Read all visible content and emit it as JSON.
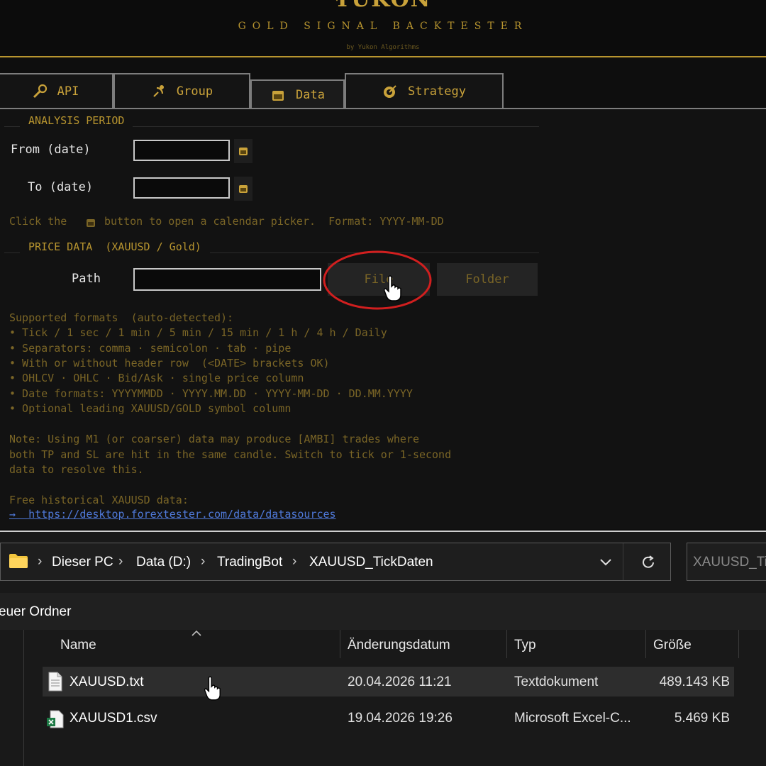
{
  "header": {
    "brand": "YUKON",
    "subtitle": "GOLD SIGNAL BACKTESTER",
    "byline": "by Yukon Algorithms"
  },
  "tabs": [
    {
      "label": "API",
      "icon": "wrench-icon"
    },
    {
      "label": "Group",
      "icon": "satellite-icon"
    },
    {
      "label": "Data",
      "icon": "calendar-icon",
      "active": true
    },
    {
      "label": "Strategy",
      "icon": "target-icon"
    }
  ],
  "analysis": {
    "title": "ANALYSIS PERIOD",
    "from_label": "From (date)",
    "to_label": "To (date)",
    "from_value": "",
    "to_value": "",
    "hint_before": "Click the",
    "hint_after": "button to open a calendar picker.  Format: YYYY-MM-DD"
  },
  "price": {
    "title": "PRICE DATA  (XAUUSD / Gold)",
    "path_label": "Path",
    "path_value": "",
    "file_button": "File",
    "folder_button": "Folder"
  },
  "formats": {
    "heading": "Supported formats  (auto-detected):",
    "items": [
      "• Tick / 1 sec / 1 min / 5 min / 15 min / 1 h / 4 h / Daily",
      "• Separators: comma · semicolon · tab · pipe",
      "• With or without header row  (<DATE> brackets OK)",
      "• OHLCV · OHLC · Bid/Ask · single price column",
      "• Date formats: YYYYMMDD · YYYY.MM.DD · YYYY-MM-DD · DD.MM.YYYY",
      "• Optional leading XAUUSD/GOLD symbol column"
    ]
  },
  "note": {
    "lines": [
      "Note: Using M1 (or coarser) data may produce [AMBI] trades where",
      "both TP and SL are hit in the same candle. Switch to tick or 1-second",
      "data to resolve this."
    ]
  },
  "free_data": {
    "label": "Free historical XAUUSD data:",
    "link": "→  https://desktop.forextester.com/data/datasources"
  },
  "explorer": {
    "breadcrumb": [
      "Dieser PC",
      "Data (D:)",
      "TradingBot",
      "XAUUSD_TickDaten"
    ],
    "search_placeholder": "XAUUSD_TickDaten",
    "new_folder": "euer Ordner",
    "columns": [
      "Name",
      "Änderungsdatum",
      "Typ",
      "Größe"
    ],
    "files": [
      {
        "name": "XAUUSD.txt",
        "modified": "20.04.2026 11:21",
        "type": "Textdokument",
        "size": "489.143 KB",
        "icon": "text-file-icon"
      },
      {
        "name": "XAUUSD1.csv",
        "modified": "19.04.2026 19:26",
        "type": "Microsoft Excel-C...",
        "size": "5.469 KB",
        "icon": "excel-file-icon"
      }
    ]
  },
  "colors": {
    "gold": "#c9a23a",
    "highlight_circle": "#d11f1f",
    "link": "#4f79d9"
  }
}
